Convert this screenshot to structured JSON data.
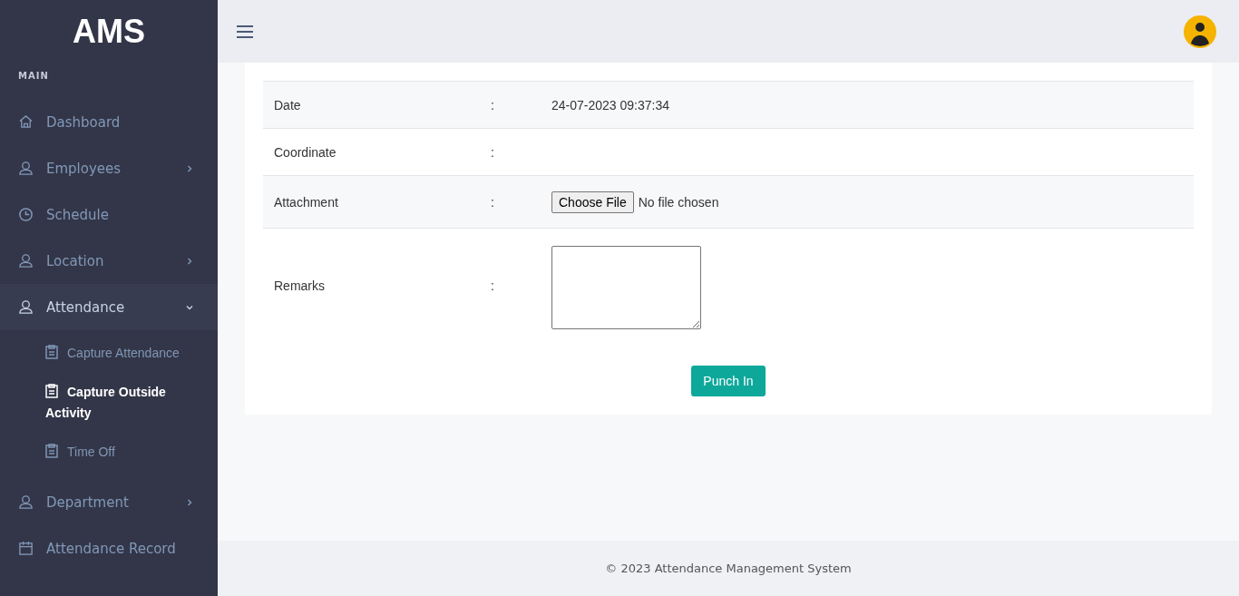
{
  "brand": "AMS",
  "sidebar": {
    "section": "MAIN",
    "items": [
      {
        "label": "Dashboard"
      },
      {
        "label": "Employees",
        "expanded": false
      },
      {
        "label": "Schedule"
      },
      {
        "label": "Location",
        "expanded": false
      },
      {
        "label": "Attendance",
        "expanded": true,
        "children": [
          {
            "label": "Capture Attendance",
            "selected": false
          },
          {
            "label": "Capture Outside Activity",
            "selected": true
          },
          {
            "label": "Time Off",
            "selected": false
          }
        ]
      },
      {
        "label": "Department",
        "expanded": false
      },
      {
        "label": "Attendance Record"
      }
    ]
  },
  "form": {
    "rows": [
      {
        "kind": "text",
        "label": "Date",
        "separator": ":",
        "value": "24-07-2023 09:37:34"
      },
      {
        "kind": "text",
        "label": "Coordinate",
        "separator": ":"
      },
      {
        "kind": "file",
        "label": "Attachment",
        "separator": ":",
        "button": "Choose File",
        "status": "No file chosen"
      },
      {
        "kind": "textarea",
        "label": "Remarks",
        "separator": ":"
      }
    ],
    "submit": "Punch In"
  },
  "footer": "© 2023 Attendance Management System"
}
